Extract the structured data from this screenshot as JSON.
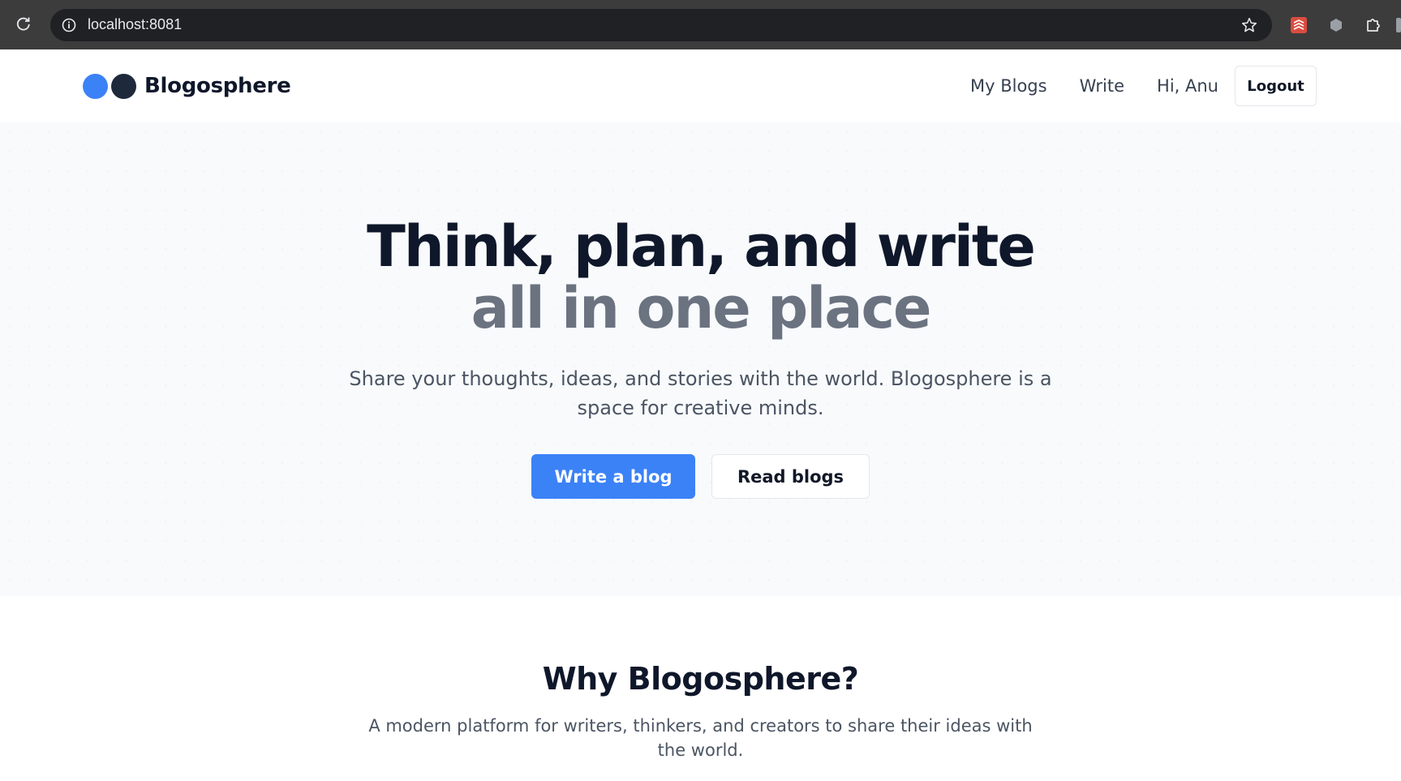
{
  "browser": {
    "url": "localhost:8081",
    "icons": [
      "reload-icon",
      "site-info-icon",
      "bookmark-star-icon",
      "extension-todoist-icon",
      "extension-hexagon-icon",
      "extensions-puzzle-icon"
    ]
  },
  "nav": {
    "brand": "Blogosphere",
    "links": [
      "My Blogs",
      "Write"
    ],
    "greeting": "Hi, Anu",
    "logout": "Logout"
  },
  "hero": {
    "title_line1": "Think, plan, and write",
    "title_line2": "all in one place",
    "subtitle": "Share your thoughts, ideas, and stories with the world. Blogosphere is a space for creative minds.",
    "primary_cta": "Write a blog",
    "secondary_cta": "Read blogs"
  },
  "why": {
    "heading": "Why Blogosphere?",
    "description": "A modern platform for writers, thinkers, and creators to share their ideas with the world."
  },
  "colors": {
    "accent": "#3b82f6",
    "heading": "#0f172a",
    "muted_heading": "#6b7280",
    "hero_bg": "#f8fafc"
  }
}
